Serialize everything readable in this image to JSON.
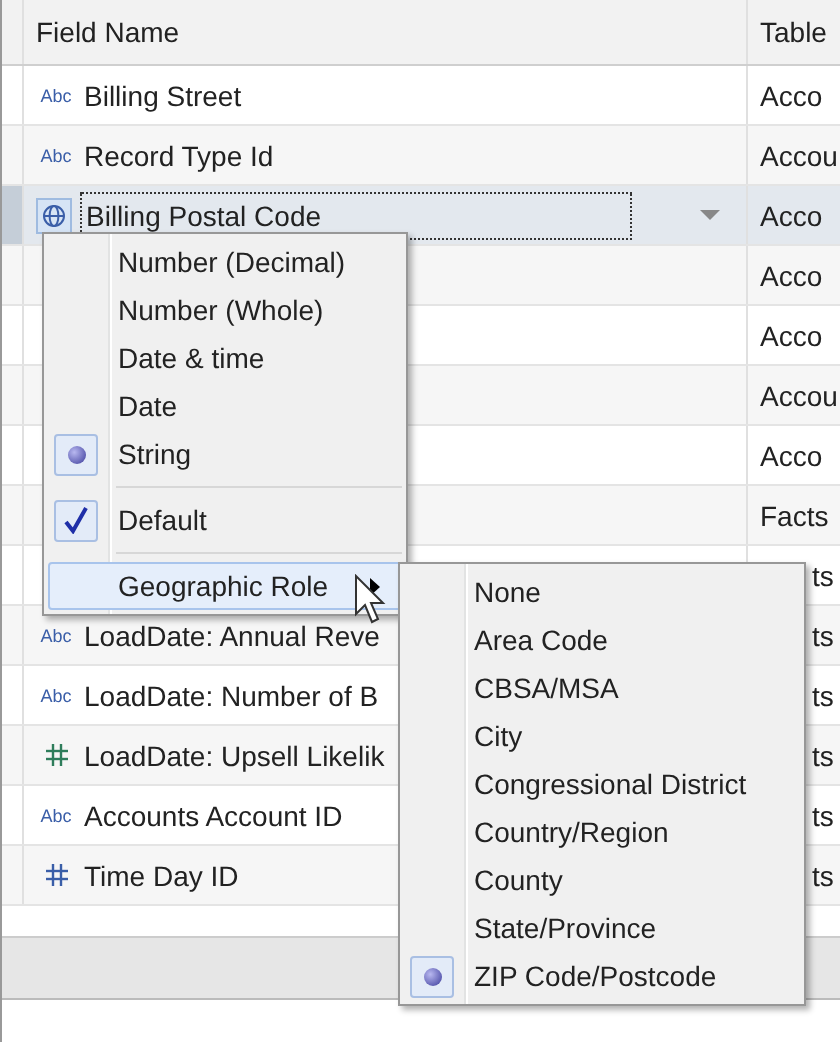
{
  "table": {
    "columns": [
      "Field Name",
      "Table"
    ],
    "rows": [
      {
        "kind": "string",
        "type_label": "Abc",
        "name": "Billing Street",
        "table": "Acco",
        "selected": false,
        "covered": false
      },
      {
        "kind": "string",
        "type_label": "Abc",
        "name": "Record Type Id",
        "table": "Accou",
        "selected": false,
        "covered": false
      },
      {
        "kind": "geo",
        "name": "Billing Postal Code",
        "table": "Acco",
        "selected": true,
        "covered": false
      },
      {
        "table": "Acco",
        "selected": false,
        "covered": false
      },
      {
        "table": "Acco",
        "selected": false,
        "covered": false
      },
      {
        "table": "Accou",
        "selected": false,
        "covered": false
      },
      {
        "table": "Acco",
        "selected": false,
        "covered": false
      },
      {
        "table": "Facts",
        "selected": false,
        "covered": false
      },
      {
        "table": "ts",
        "selected": false,
        "covered": true
      },
      {
        "kind": "string",
        "type_label": "Abc",
        "name": "LoadDate: Annual Reve",
        "table": "ts",
        "selected": false,
        "covered": true
      },
      {
        "kind": "string",
        "type_label": "Abc",
        "name": "LoadDate: Number of B",
        "table": "ts",
        "selected": false,
        "covered": true
      },
      {
        "kind": "number",
        "color": "#2e7d5b",
        "name": "LoadDate: Upsell Likelik",
        "table": "ts",
        "selected": false,
        "covered": true
      },
      {
        "kind": "string",
        "type_label": "Abc",
        "name": "Accounts Account ID",
        "table": "ts",
        "selected": false,
        "covered": true
      },
      {
        "kind": "number",
        "color": "#3a5ea8",
        "name": "Time Day ID",
        "table": "ts",
        "selected": false,
        "covered": true
      }
    ]
  },
  "type_menu": {
    "items": [
      {
        "kind": "radio",
        "label": "Number (Decimal)",
        "selected": false
      },
      {
        "kind": "radio",
        "label": "Number (Whole)",
        "selected": false
      },
      {
        "kind": "radio",
        "label": "Date & time",
        "selected": false
      },
      {
        "kind": "radio",
        "label": "Date",
        "selected": false
      },
      {
        "kind": "radio",
        "label": "String",
        "selected": true
      },
      {
        "kind": "separator"
      },
      {
        "kind": "check",
        "label": "Default",
        "checked": true
      },
      {
        "kind": "separator"
      },
      {
        "kind": "submenu",
        "label": "Geographic Role",
        "highlighted": true
      }
    ]
  },
  "role_menu": {
    "items": [
      {
        "label": "None",
        "selected": false
      },
      {
        "label": "Area Code",
        "selected": false
      },
      {
        "label": "CBSA/MSA",
        "selected": false
      },
      {
        "label": "City",
        "selected": false
      },
      {
        "label": "Congressional District",
        "selected": false
      },
      {
        "label": "Country/Region",
        "selected": false
      },
      {
        "label": "County",
        "selected": false
      },
      {
        "label": "State/Province",
        "selected": false
      },
      {
        "label": "ZIP Code/Postcode",
        "selected": true
      }
    ]
  }
}
